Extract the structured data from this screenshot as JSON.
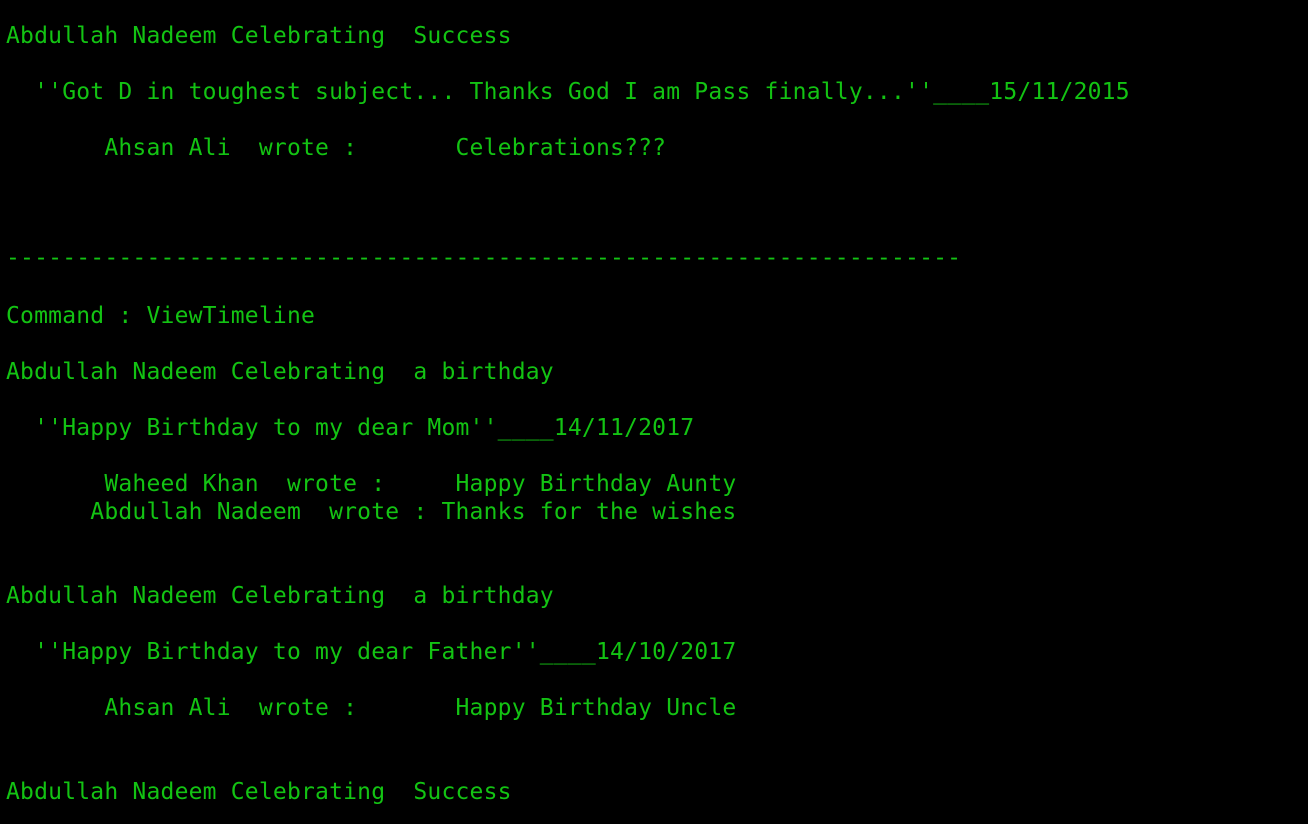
{
  "console": {
    "text_color": "#13c313",
    "background_color": "#000000",
    "lines": [
      "Abdullah Nadeem Celebrating  Success",
      "  ''Got D in toughest subject... Thanks God I am Pass finally...''____15/11/2015",
      "       Ahsan Ali  wrote :       Celebrations???",
      "--------------------------------------------------------------------",
      "Command : ViewTimeline",
      "Abdullah Nadeem Celebrating  a birthday",
      "  ''Happy Birthday to my dear Mom''____14/11/2017",
      "       Waheed Khan  wrote :     Happy Birthday Aunty",
      "      Abdullah Nadeem  wrote : Thanks for the wishes",
      "Abdullah Nadeem Celebrating  a birthday",
      "  ''Happy Birthday to my dear Father''____14/10/2017",
      "       Ahsan Ali  wrote :       Happy Birthday Uncle",
      "Abdullah Nadeem Celebrating  Success"
    ]
  }
}
